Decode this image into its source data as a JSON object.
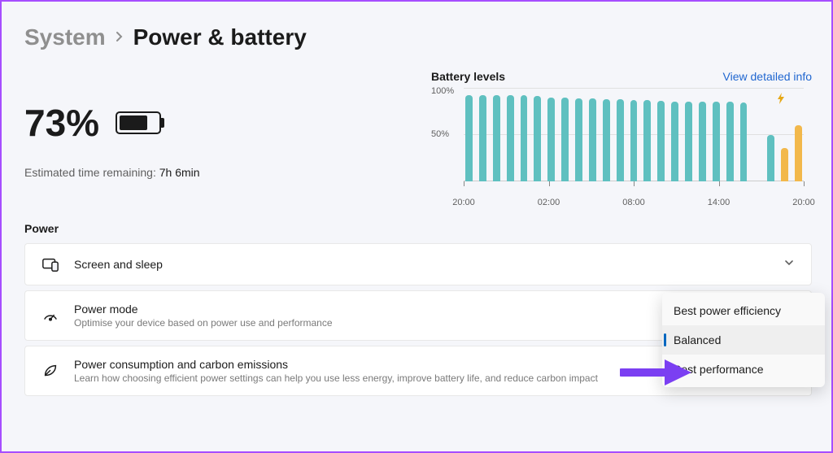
{
  "breadcrumb": {
    "parent": "System",
    "current": "Power & battery"
  },
  "battery": {
    "percent": "73%",
    "fill_pct": 73,
    "estimated_label": "Estimated time remaining:",
    "estimated_value": "7h 6min"
  },
  "chart": {
    "title": "Battery levels",
    "link": "View detailed info",
    "y_ticks": [
      "100%",
      "50%"
    ],
    "x_ticks": [
      "20:00",
      "02:00",
      "08:00",
      "14:00",
      "20:00"
    ]
  },
  "chart_data": {
    "type": "bar",
    "xlabel": "",
    "ylabel": "",
    "ylim": [
      0,
      100
    ],
    "x_range": [
      "20:00",
      "20:00"
    ],
    "bars": [
      {
        "h": 92,
        "c": "teal"
      },
      {
        "h": 92,
        "c": "teal"
      },
      {
        "h": 92,
        "c": "teal"
      },
      {
        "h": 92,
        "c": "teal"
      },
      {
        "h": 92,
        "c": "teal"
      },
      {
        "h": 91,
        "c": "teal"
      },
      {
        "h": 90,
        "c": "teal"
      },
      {
        "h": 90,
        "c": "teal"
      },
      {
        "h": 89,
        "c": "teal"
      },
      {
        "h": 89,
        "c": "teal"
      },
      {
        "h": 88,
        "c": "teal"
      },
      {
        "h": 88,
        "c": "teal"
      },
      {
        "h": 87,
        "c": "teal"
      },
      {
        "h": 87,
        "c": "teal"
      },
      {
        "h": 86,
        "c": "teal"
      },
      {
        "h": 85,
        "c": "teal"
      },
      {
        "h": 85,
        "c": "teal"
      },
      {
        "h": 85,
        "c": "teal"
      },
      {
        "h": 85,
        "c": "teal"
      },
      {
        "h": 85,
        "c": "teal"
      },
      {
        "h": 84,
        "c": "teal"
      },
      {
        "h": 0,
        "c": "empty"
      },
      {
        "h": 50,
        "c": "teal"
      },
      {
        "h": 36,
        "c": "orange"
      },
      {
        "h": 60,
        "c": "orange"
      }
    ]
  },
  "section": {
    "power_label": "Power"
  },
  "cards": {
    "screen": {
      "title": "Screen and sleep"
    },
    "mode": {
      "title": "Power mode",
      "sub": "Optimise your device based on power use and performance"
    },
    "carbon": {
      "title": "Power consumption and carbon emissions",
      "sub": "Learn how choosing efficient power settings can help you use less energy, improve battery life, and reduce carbon impact"
    }
  },
  "dropdown": {
    "items": [
      {
        "label": "Best power efficiency",
        "selected": false
      },
      {
        "label": "Balanced",
        "selected": true
      },
      {
        "label": "Best performance",
        "selected": false
      }
    ]
  },
  "colors": {
    "teal": "#5fc0c0",
    "orange": "#f2b84b",
    "link": "#1f66d0",
    "accent": "#0067c0",
    "annotation": "#7b3ff2"
  }
}
